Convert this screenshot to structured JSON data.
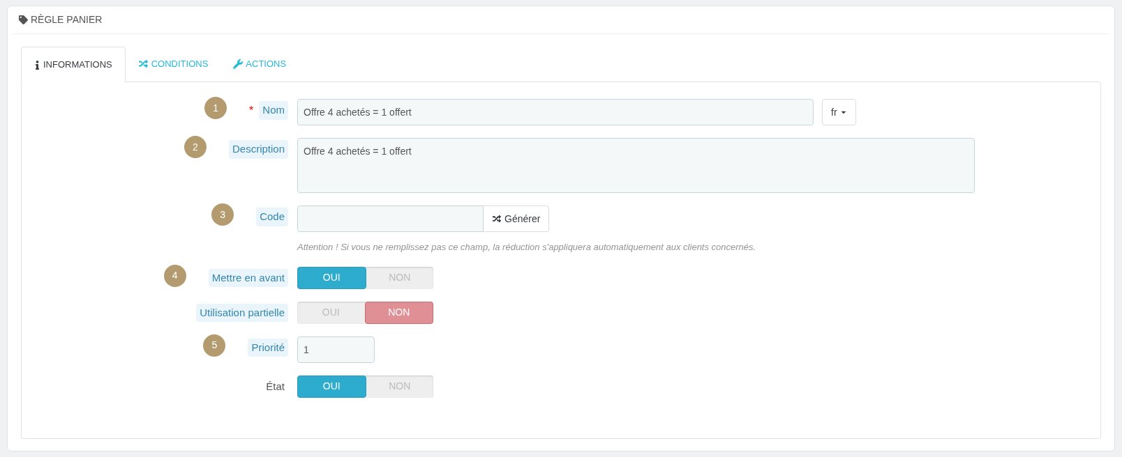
{
  "panel": {
    "title": "RÈGLE PANIER"
  },
  "tabs": [
    {
      "label": "INFORMATIONS",
      "selected": true
    },
    {
      "label": "CONDITIONS",
      "selected": false
    },
    {
      "label": "ACTIONS",
      "selected": false
    }
  ],
  "fields": [
    {
      "kind": "text",
      "step": "1",
      "required_mark": "*",
      "label": "Nom",
      "hint": true,
      "value": "Offre 4 achetés = 1 offert",
      "language": "fr"
    },
    {
      "kind": "textarea",
      "step": "2",
      "label": "Description",
      "hint": true,
      "value": "Offre 4 achetés = 1 offert"
    },
    {
      "kind": "code",
      "step": "3",
      "label": "Code",
      "hint": true,
      "button": "Générer",
      "help": "Attention ! Si vous ne remplissez pas ce champ, la réduction s'appliquera automatiquement aux clients concernés."
    },
    {
      "kind": "switch",
      "step": "4",
      "label": "Mettre en avant",
      "hint": true,
      "options": [
        {
          "label": "OUI",
          "selected": true
        },
        {
          "label": "NON",
          "selected": false
        }
      ]
    },
    {
      "kind": "switch",
      "label": "Utilisation partielle",
      "hint": true,
      "options": [
        {
          "label": "OUI",
          "selected": false
        },
        {
          "label": "NON",
          "selected": true
        }
      ]
    },
    {
      "kind": "number",
      "step": "5",
      "label": "Priorité",
      "hint": true,
      "value": "1"
    },
    {
      "kind": "switch",
      "label": "État",
      "hint": false,
      "options": [
        {
          "label": "OUI",
          "selected": true
        },
        {
          "label": "NON",
          "selected": false
        }
      ]
    }
  ]
}
